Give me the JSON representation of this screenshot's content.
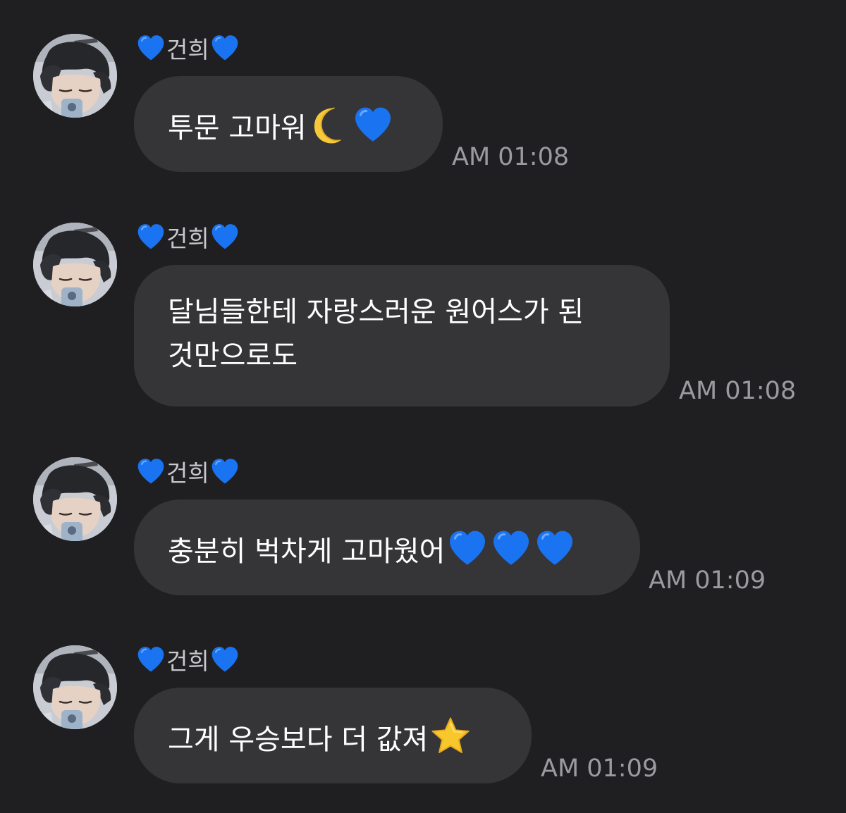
{
  "colors": {
    "background": "#1f1f21",
    "bubble": "#353538",
    "text": "#ffffff",
    "sender_name": "#c8c8cc",
    "timestamp": "#9a9aa0",
    "heart_blue": "#1a73f0",
    "moon_yellow": "#f5c93a",
    "star_yellow": "#f8c72c"
  },
  "messages": [
    {
      "sender": "건희",
      "sender_icon": "blue-heart-icon",
      "text": "투문 고마워",
      "emojis": [
        "crescent-moon-icon",
        "blue-heart-icon"
      ],
      "time": "AM 01:08"
    },
    {
      "sender": "건희",
      "sender_icon": "blue-heart-icon",
      "text_line1": "달님들한테 자랑스러운 원어스가 된",
      "text_line2": "것만으로도",
      "emojis": [],
      "time": "AM 01:08"
    },
    {
      "sender": "건희",
      "sender_icon": "blue-heart-icon",
      "text": "충분히 벅차게 고마웠어",
      "emojis": [
        "blue-heart-icon",
        "blue-heart-icon",
        "blue-heart-icon"
      ],
      "time": "AM 01:09"
    },
    {
      "sender": "건희",
      "sender_icon": "blue-heart-icon",
      "text": "그게 우승보다 더 값져",
      "emojis": [
        "star-icon"
      ],
      "time": "AM 01:09"
    }
  ]
}
